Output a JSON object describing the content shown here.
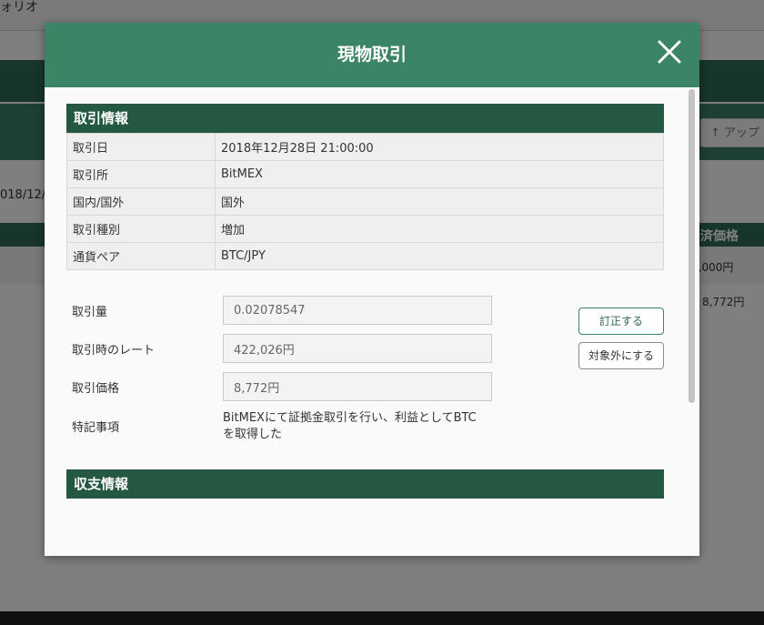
{
  "background": {
    "topbar_text": "ォリオ",
    "upload_button": "↑ アップ",
    "date_text": "018/12/",
    "table_head_right": "済価格",
    "cell_row1": "0,000円",
    "cell_row2": "8,772円"
  },
  "modal": {
    "title": "現物取引",
    "trade_info": {
      "title": "取引情報",
      "rows": [
        {
          "label": "取引日",
          "value": "2018年12月28日 21:00:00"
        },
        {
          "label": "取引所",
          "value": "BitMEX"
        },
        {
          "label": "国内/国外",
          "value": "国外"
        },
        {
          "label": "取引種別",
          "value": "増加"
        },
        {
          "label": "通貨ペア",
          "value": "BTC/JPY"
        }
      ]
    },
    "form": {
      "amount_label": "取引量",
      "amount_value": "0.02078547",
      "rate_label": "取引時のレート",
      "rate_value": "422,026円",
      "price_label": "取引価格",
      "price_value": "8,772円",
      "note_label": "特記事項",
      "note_text": "BitMEXにて証拠金取引を行い、利益としてBTCを取得した"
    },
    "buttons": {
      "correct": "訂正する",
      "exclude": "対象外にする"
    },
    "balance_info": {
      "title": "収支情報"
    }
  }
}
